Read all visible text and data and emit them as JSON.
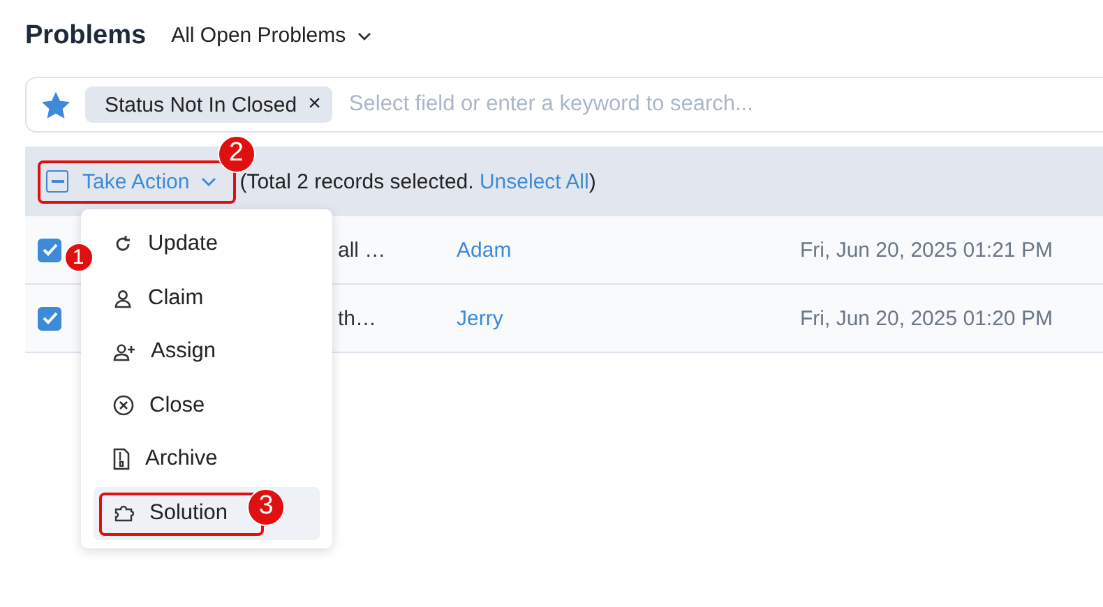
{
  "header": {
    "title": "Problems",
    "view": "All Open Problems"
  },
  "search": {
    "filter_chip": "Status Not In Closed",
    "chip_remove": "×",
    "placeholder": "Select field or enter a keyword to search..."
  },
  "action_bar": {
    "select_all_partial": true,
    "take_action": "Take Action",
    "take_action_step": "2",
    "summary_start": "(Total 2 records selected. ",
    "unselect": "Unselect All",
    "summary_end": ")"
  },
  "rows": [
    {
      "checked": true,
      "step": "1",
      "subject": "all …",
      "requester": "Adam",
      "date": "Fri, Jun 20, 2025 01:21 PM"
    },
    {
      "checked": true,
      "subject": "th…",
      "requester": "Jerry",
      "date": "Fri, Jun 20, 2025 01:20 PM"
    }
  ],
  "menu": [
    {
      "kind": "update",
      "label": "Update",
      "selected": false
    },
    {
      "kind": "claim",
      "label": "Claim",
      "selected": false
    },
    {
      "kind": "assign",
      "label": "Assign",
      "selected": false
    },
    {
      "kind": "close",
      "label": "Close",
      "selected": false
    },
    {
      "kind": "archive",
      "label": "Archive",
      "selected": false
    },
    {
      "kind": "solution",
      "label": "Solution",
      "selected": true,
      "step": "3"
    }
  ]
}
